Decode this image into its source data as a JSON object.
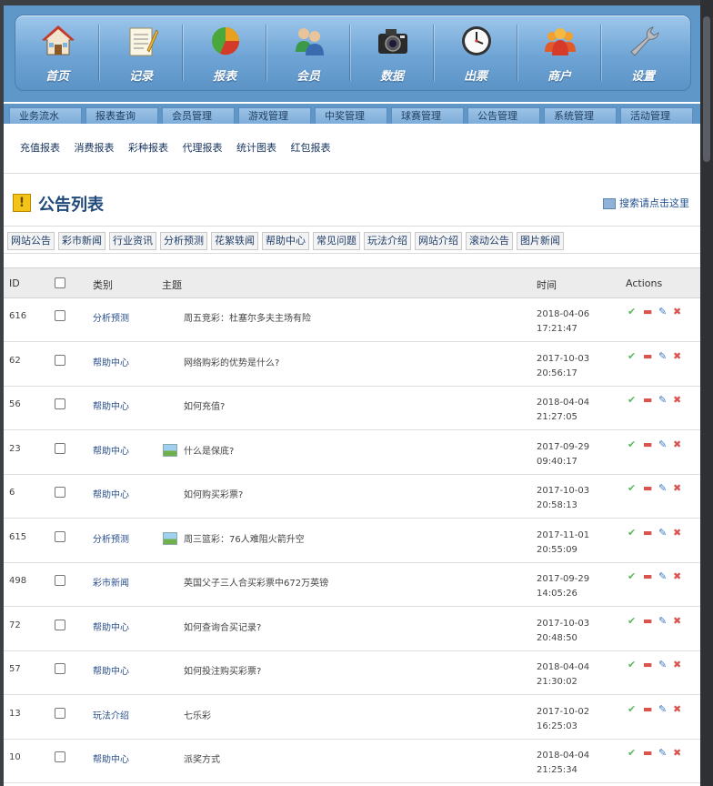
{
  "topnav": [
    {
      "label": "首页",
      "icon": "home-icon"
    },
    {
      "label": "记录",
      "icon": "notepad-icon"
    },
    {
      "label": "报表",
      "icon": "pie-chart-icon"
    },
    {
      "label": "会员",
      "icon": "users-icon"
    },
    {
      "label": "数据",
      "icon": "camera-icon"
    },
    {
      "label": "出票",
      "icon": "clock-icon"
    },
    {
      "label": "商户",
      "icon": "merchant-group-icon"
    },
    {
      "label": "设置",
      "icon": "wrench-icon"
    }
  ],
  "subtabs": [
    "业务流水",
    "报表查询",
    "会员管理",
    "游戏管理",
    "中奖管理",
    "球赛管理",
    "公告管理",
    "系统管理",
    "活动管理"
  ],
  "sublinks": [
    "充值报表",
    "消费报表",
    "彩种报表",
    "代理报表",
    "统计图表",
    "红包报表"
  ],
  "page": {
    "title": "公告列表",
    "search_link": "搜索请点击这里"
  },
  "categories": [
    "网站公告",
    "彩市新闻",
    "行业资讯",
    "分析预测",
    "花絮轶闻",
    "帮助中心",
    "常见问题",
    "玩法介绍",
    "网站介绍",
    "滚动公告",
    "图片新闻"
  ],
  "table": {
    "headers": {
      "id": "ID",
      "category": "类别",
      "subject": "主题",
      "time": "时间",
      "actions": "Actions"
    },
    "rows": [
      {
        "id": "616",
        "category": "分析预测",
        "subject": "周五竞彩：杜塞尔多夫主场有险",
        "has_image": false,
        "date": "2018-04-06",
        "clock": "17:21:47"
      },
      {
        "id": "62",
        "category": "帮助中心",
        "subject": "网络购彩的优势是什么?",
        "has_image": false,
        "date": "2017-10-03",
        "clock": "20:56:17"
      },
      {
        "id": "56",
        "category": "帮助中心",
        "subject": "如何充值?",
        "has_image": false,
        "date": "2018-04-04",
        "clock": "21:27:05"
      },
      {
        "id": "23",
        "category": "帮助中心",
        "subject": "什么是保底?",
        "has_image": true,
        "date": "2017-09-29",
        "clock": "09:40:17"
      },
      {
        "id": "6",
        "category": "帮助中心",
        "subject": "如何购买彩票?",
        "has_image": false,
        "date": "2017-10-03",
        "clock": "20:58:13"
      },
      {
        "id": "615",
        "category": "分析预测",
        "subject": "周三篮彩：76人难阻火箭升空",
        "has_image": true,
        "date": "2017-11-01",
        "clock": "20:55:09"
      },
      {
        "id": "498",
        "category": "彩市新闻",
        "subject": "英国父子三人合买彩票中672万英镑",
        "has_image": false,
        "date": "2017-09-29",
        "clock": "14:05:26"
      },
      {
        "id": "72",
        "category": "帮助中心",
        "subject": "如何查询合买记录?",
        "has_image": false,
        "date": "2017-10-03",
        "clock": "20:48:50"
      },
      {
        "id": "57",
        "category": "帮助中心",
        "subject": "如何投注购买彩票?",
        "has_image": false,
        "date": "2018-04-04",
        "clock": "21:30:02"
      },
      {
        "id": "13",
        "category": "玩法介绍",
        "subject": "七乐彩",
        "has_image": false,
        "date": "2017-10-02",
        "clock": "16:25:03"
      },
      {
        "id": "10",
        "category": "帮助中心",
        "subject": "派奖方式",
        "has_image": false,
        "date": "2018-04-04",
        "clock": "21:25:34"
      }
    ]
  },
  "colors": {
    "approve": "#5cb85c",
    "remove": "#d9534f",
    "edit": "#3a78c3",
    "delete": "#d9534f"
  }
}
